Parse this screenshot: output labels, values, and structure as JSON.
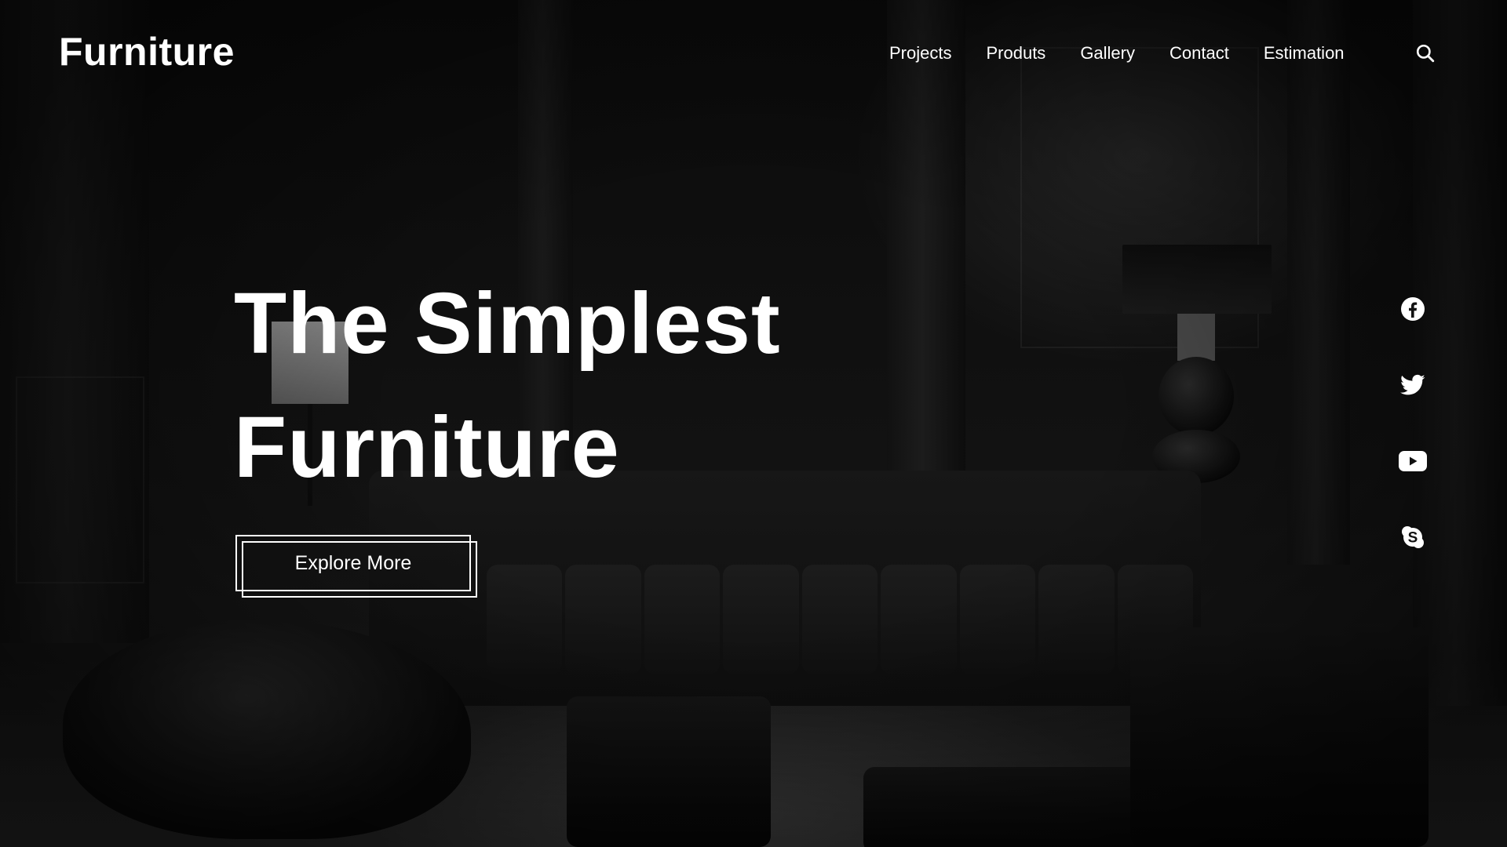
{
  "header": {
    "logo": "Furniture",
    "nav": [
      {
        "label": "Projects"
      },
      {
        "label": "Produts"
      },
      {
        "label": "Gallery"
      },
      {
        "label": "Contact"
      },
      {
        "label": "Estimation"
      }
    ],
    "search_icon": "search-icon"
  },
  "hero": {
    "headline_line1": "The Simplest",
    "headline_line2": "Furniture",
    "cta_label": "Explore More"
  },
  "social": {
    "icons": [
      "facebook-icon",
      "twitter-icon",
      "youtube-icon",
      "skype-icon"
    ]
  },
  "colors": {
    "text": "#ffffff",
    "background": "#0a0a0a"
  }
}
